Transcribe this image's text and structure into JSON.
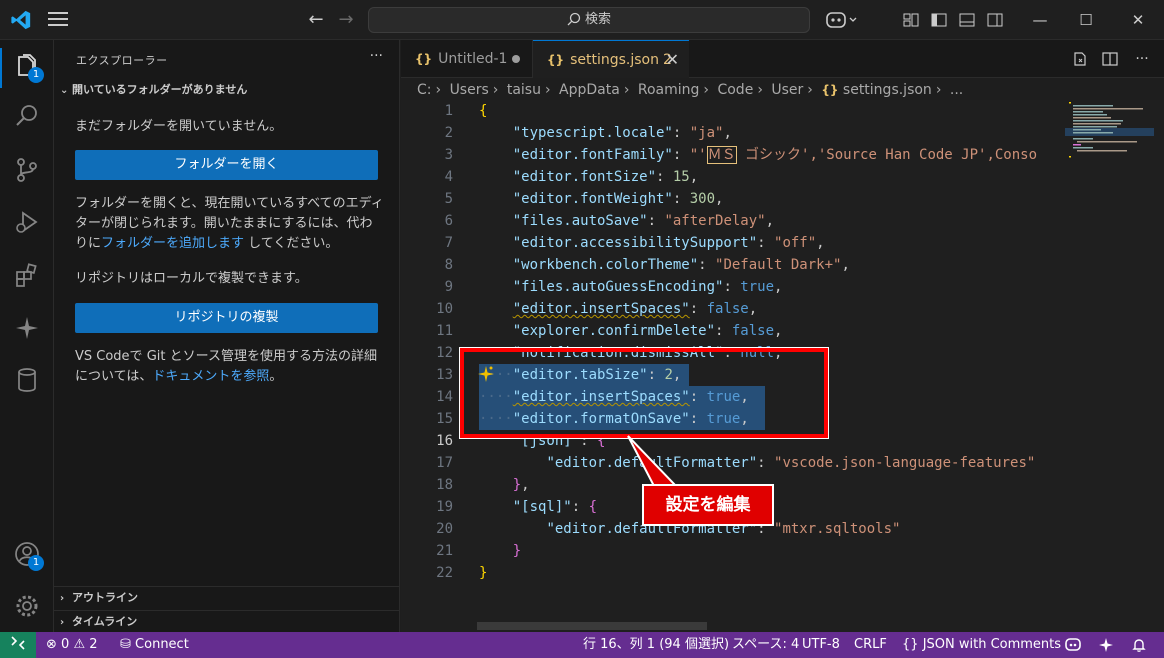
{
  "titlebar": {
    "search_label": "検索"
  },
  "activity": {
    "explorer_badge": "1",
    "accounts_badge": "1"
  },
  "sidebar": {
    "title": "エクスプローラー",
    "more": "···",
    "section_title": "開いているフォルダーがありません",
    "no_folder_text": "まだフォルダーを開いていません。",
    "open_folder_button": "フォルダーを開く",
    "open_folder_desc_1": "フォルダーを開くと、現在開いているすべてのエディターが閉じられます。開いたままにするには、代わりに",
    "open_folder_desc_link": "フォルダーを追加します",
    "open_folder_desc_2": "してください。",
    "repo_text": "リポジトリはローカルで複製できます。",
    "clone_button": "リポジトリの複製",
    "git_text_1": "VS Codeで Git とソース管理を使用する方法の詳細については、",
    "git_link": "ドキュメントを参照",
    "git_text_2": "。",
    "outline": "アウトライン",
    "timeline": "タイムライン"
  },
  "tabs": [
    {
      "label": "Untitled-1"
    },
    {
      "label": "settings.json",
      "problems": "2"
    }
  ],
  "breadcrumb": [
    "C:",
    "Users",
    "taisu",
    "AppData",
    "Roaming",
    "Code",
    "User",
    "settings.json",
    "..."
  ],
  "code_lines": [
    "1",
    "2",
    "3",
    "4",
    "5",
    "6",
    "7",
    "8",
    "9",
    "10",
    "11",
    "12",
    "13",
    "14",
    "15",
    "16",
    "17",
    "18",
    "19",
    "20",
    "21",
    "22"
  ],
  "code": {
    "l2k": "\"typescript.locale\"",
    "l2v": "\"ja\"",
    "l3k": "\"editor.fontFamily\"",
    "l3a": "\"'",
    "l3ms": "ＭＳ",
    "l3b": " ゴシック','Source Han Code JP',Conso",
    "l4k": "\"editor.fontSize\"",
    "l4v": "15",
    "l5k": "\"editor.fontWeight\"",
    "l5v": "300",
    "l6k": "\"files.autoSave\"",
    "l6v": "\"afterDelay\"",
    "l7k": "\"editor.accessibilitySupport\"",
    "l7v": "\"off\"",
    "l8k": "\"workbench.colorTheme\"",
    "l8v": "\"Default Dark+\"",
    "l9k": "\"files.autoGuessEncoding\"",
    "l9v": "true",
    "l10k": "\"editor.insertSpaces\"",
    "l10v": "false",
    "l11k": "\"explorer.confirmDelete\"",
    "l11v": "false",
    "l12k": "\"notification.dismissAll\"",
    "l12v": "null",
    "l13k": "\"editor.tabSize\"",
    "l13v": "2",
    "l14k": "\"editor.insertSpaces\"",
    "l14v": "true",
    "l15k": "\"editor.formatOnSave\"",
    "l15v": "true",
    "l16k": "\"[json]\"",
    "l17k": "\"editor.defaultFormatter\"",
    "l17v": "\"vscode.json-language-features\"",
    "l19k": "\"[sql]\"",
    "l20k": "\"editor.defaultFormatter\"",
    "l20v": "\"mtxr.sqltools\""
  },
  "annotation": {
    "label": "設定を編集"
  },
  "statusbar": {
    "errors": "0",
    "warnings": "2",
    "connect": "Connect",
    "position": "行 16、列 1 (94 個選択)",
    "spaces": "スペース: 4",
    "encoding": "UTF-8",
    "eol": "CRLF",
    "language": "JSON with Comments"
  },
  "colors": {
    "accent": "#0078d4",
    "statusbar": "#652d90",
    "remote": "#16825d",
    "annotation": "#e00000"
  }
}
